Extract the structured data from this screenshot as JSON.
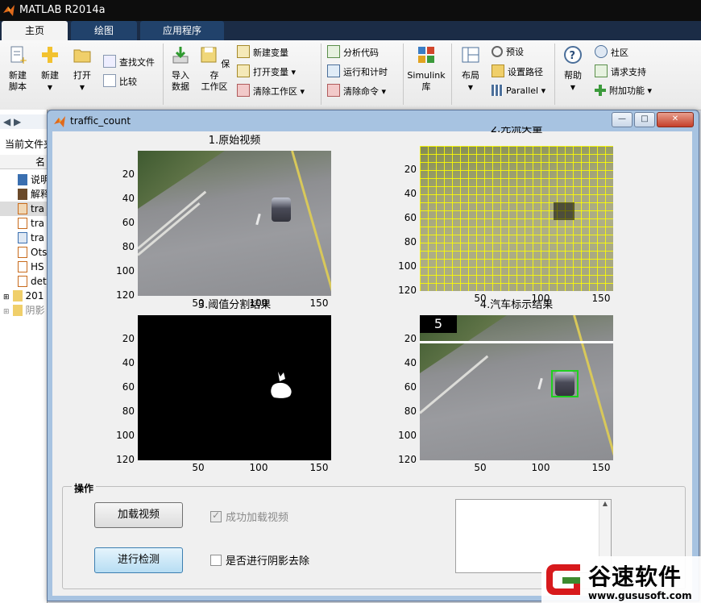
{
  "main_window": {
    "title": "MATLAB R2014a",
    "tabs": [
      "主页",
      "绘图",
      "应用程序"
    ],
    "ribbon": {
      "new_script": "新建\n脚本",
      "new": "新建",
      "open": "打开",
      "find_files": "查找文件",
      "compare": "比较",
      "import_data": "导入\n数据",
      "save_workspace": "保存\n工作区",
      "new_variable": "新建变量",
      "open_variable": "打开变量",
      "clear_workspace": "清除工作区",
      "analyze_code": "分析代码",
      "run_and_time": "运行和计时",
      "clear_commands": "清除命令",
      "simulink": "Simulink\n库",
      "layout": "布局",
      "preferences": "预设",
      "set_path": "设置路径",
      "parallel": "Parallel",
      "help": "帮助",
      "community": "社区",
      "request_support": "请求支持",
      "addons": "附加功能"
    },
    "left_panel": {
      "header": "当前文件夹",
      "col": "名",
      "files": [
        "说明",
        "解释",
        "tra",
        "tra",
        "tra",
        "Ots",
        "HS",
        "det",
        "201",
        "阴影"
      ]
    }
  },
  "figure": {
    "title": "traffic_count",
    "buttons": {
      "min": "—",
      "max": "□",
      "close": "✕"
    },
    "axes": [
      {
        "title": "1.原始视频",
        "yticks": [
          "20",
          "40",
          "60",
          "80",
          "100",
          "120"
        ],
        "xticks": [
          "50",
          "100",
          "150"
        ]
      },
      {
        "title": "2.光流矢量",
        "yticks": [
          "20",
          "40",
          "60",
          "80",
          "100",
          "120"
        ],
        "xticks": [
          "50",
          "100",
          "150"
        ]
      },
      {
        "title": "3.阈值分割结果",
        "yticks": [
          "20",
          "40",
          "60",
          "80",
          "100",
          "120"
        ],
        "xticks": [
          "50",
          "100",
          "150"
        ]
      },
      {
        "title": "4.汽车标示结果",
        "yticks": [
          "20",
          "40",
          "60",
          "80",
          "100",
          "120"
        ],
        "xticks": [
          "50",
          "100",
          "150"
        ],
        "count": "5"
      }
    ],
    "panel": {
      "label": "操作",
      "load_button": "加载视频",
      "detect_button": "进行检测",
      "loaded_checkbox": "成功加载视频",
      "loaded_checked": true,
      "shadow_checkbox": "是否进行阴影去除",
      "shadow_checked": false
    }
  },
  "watermark": {
    "name": "谷速软件",
    "url": "www.gususoft.com"
  }
}
